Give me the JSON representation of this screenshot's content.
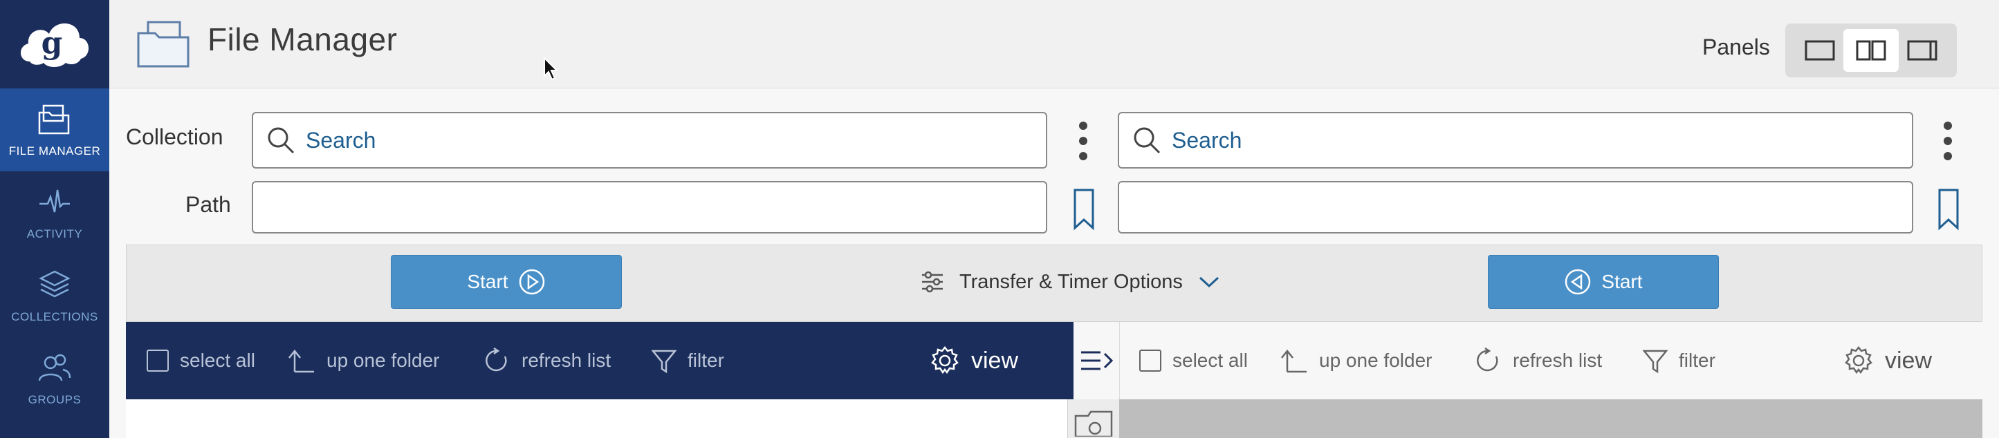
{
  "app": {
    "title": "File Manager"
  },
  "sidebar": {
    "items": [
      {
        "label": "FILE MANAGER",
        "icon": "folder-icon",
        "active": true
      },
      {
        "label": "ACTIVITY",
        "icon": "activity-icon",
        "active": false
      },
      {
        "label": "COLLECTIONS",
        "icon": "layers-icon",
        "active": false
      },
      {
        "label": "GROUPS",
        "icon": "groups-icon",
        "active": false
      }
    ]
  },
  "header": {
    "panels_label": "Panels",
    "panel_options": [
      "single-panel-icon",
      "double-panel-icon",
      "right-panel-icon"
    ],
    "active_panel_option": 1
  },
  "form": {
    "collection_label": "Collection",
    "path_label": "Path",
    "left": {
      "search_placeholder": "Search",
      "path_value": ""
    },
    "right": {
      "search_placeholder": "Search",
      "path_value": ""
    }
  },
  "transfer": {
    "start_left_label": "Start",
    "start_right_label": "Start",
    "options_label": "Transfer & Timer Options"
  },
  "toolbar": {
    "select_all": "select all",
    "up_one_folder": "up one folder",
    "refresh_list": "refresh list",
    "filter": "filter",
    "view": "view"
  },
  "colors": {
    "sidebar_bg": "#1b2d5a",
    "sidebar_active": "#23509a",
    "accent": "#4a90c8",
    "link": "#1e5e90"
  }
}
